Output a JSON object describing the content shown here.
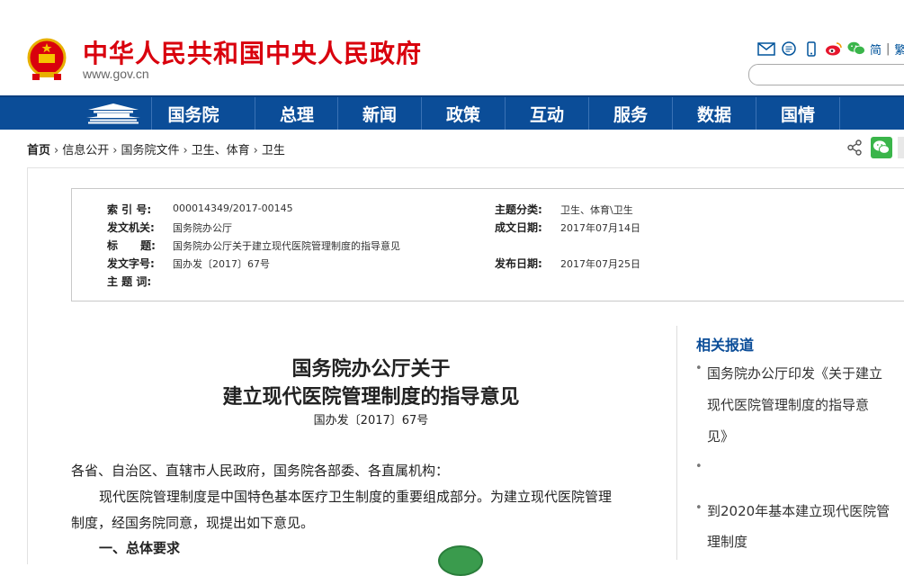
{
  "header": {
    "site_title": "中华人民共和国中央人民政府",
    "site_url": "www.gov.cn",
    "links": {
      "simplified": "简",
      "separator": "|",
      "traditional": "繁"
    },
    "icons": [
      "mail-icon",
      "chat-icon",
      "mobile-icon",
      "weibo-icon",
      "wechat-icon"
    ],
    "colors": {
      "brand_red": "#d9000d",
      "nav_blue": "#0b4d98"
    }
  },
  "nav": {
    "items": [
      "国务院",
      "总理",
      "新闻",
      "政策",
      "互动",
      "服务",
      "数据",
      "国情"
    ]
  },
  "breadcrumb": [
    "首页",
    "信息公开",
    "国务院文件",
    "卫生、体育",
    "卫生"
  ],
  "meta": {
    "index_label": "索 引 号:",
    "index_value": "000014349/2017-00145",
    "issuer_label": "发文机关:",
    "issuer_value": "国务院办公厅",
    "title_label": "标      题:",
    "title_value": "国务院办公厅关于建立现代医院管理制度的指导意见",
    "docno_label": "发文字号:",
    "docno_value": "国办发〔2017〕67号",
    "keywords_label": "主 题 词:",
    "topic_label": "主题分类:",
    "topic_value": "卫生、体育\\卫生",
    "written_label": "成文日期:",
    "written_value": "2017年07月14日",
    "published_label": "发布日期:",
    "published_value": "2017年07月25日"
  },
  "article": {
    "title_line1": "国务院办公厅关于",
    "title_line2": "建立现代医院管理制度的指导意见",
    "doc_number": "国办发〔2017〕67号",
    "salutation": "各省、自治区、直辖市人民政府，国务院各部委、各直属机构：",
    "para1_line1": "现代医院管理制度是中国特色基本医疗卫生制度的重要组成部分。为建立现代医院管理",
    "para1_line2": "制度，经国务院同意，现提出如下意见。",
    "section1": "一、总体要求"
  },
  "related": {
    "title": "相关报道",
    "item1_line1": "国务院办公厅印发《关于建立",
    "item1_line2": "现代医院管理制度的指导意",
    "item1_line3": "见》",
    "item3_line1": "到2020年基本建立现代医院管",
    "item3_line2": "理制度"
  }
}
